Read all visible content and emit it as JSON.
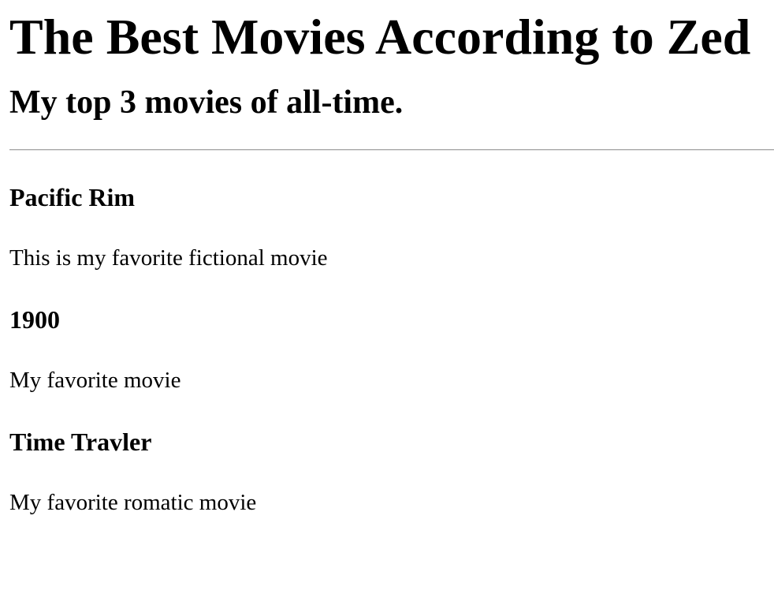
{
  "page": {
    "title": "The Best Movies According to Zed",
    "subtitle": "My top 3 movies of all-time."
  },
  "movies": [
    {
      "name": "Pacific Rim",
      "description": "This is my favorite fictional movie"
    },
    {
      "name": "1900",
      "description": "My favorite movie"
    },
    {
      "name": "Time Travler",
      "description": "My favorite romatic movie"
    }
  ]
}
